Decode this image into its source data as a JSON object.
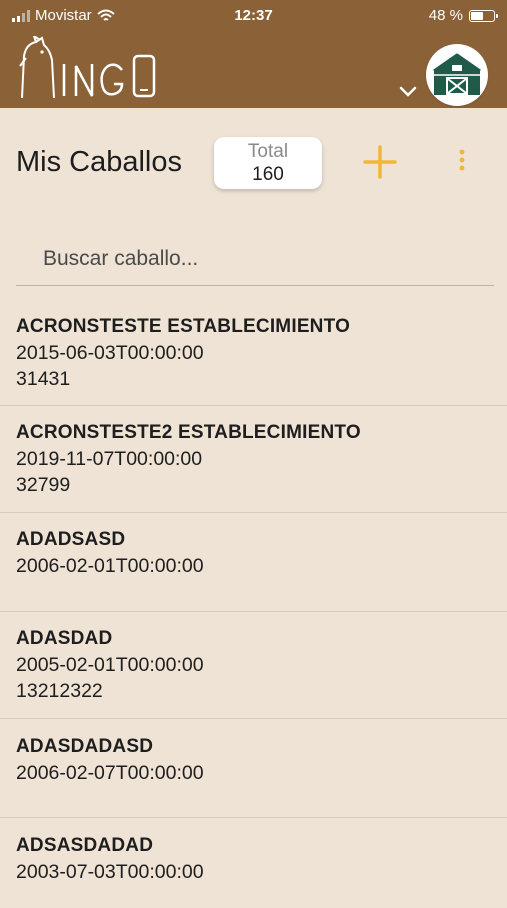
{
  "status_bar": {
    "carrier": "Movistar",
    "time": "12:37",
    "battery": "48 %",
    "battery_level": 0.48
  },
  "header": {
    "logo_text": "MINGO",
    "avatar_icon": "barn-icon",
    "colors": {
      "header_bg": "#8b6138",
      "barn": "#1f5b48",
      "accent": "#f2b634"
    }
  },
  "toolbar": {
    "title": "Mis Caballos",
    "total_label": "Total",
    "total_value": "160"
  },
  "search": {
    "placeholder": "Buscar caballo..."
  },
  "horses": [
    {
      "name": "ACRONSTESTE ESTABLECIMIENTO",
      "date": "2015-06-03T00:00:00",
      "id": "31431"
    },
    {
      "name": "ACRONSTESTE2 ESTABLECIMIENTO",
      "date": "2019-11-07T00:00:00",
      "id": "32799"
    },
    {
      "name": "ADADSASD",
      "date": "2006-02-01T00:00:00",
      "id": ""
    },
    {
      "name": "ADASDAD",
      "date": "2005-02-01T00:00:00",
      "id": "13212322"
    },
    {
      "name": "ADASDADASD",
      "date": "2006-02-07T00:00:00",
      "id": ""
    },
    {
      "name": "ADSASDADAD",
      "date": "2003-07-03T00:00:00",
      "id": ""
    }
  ]
}
